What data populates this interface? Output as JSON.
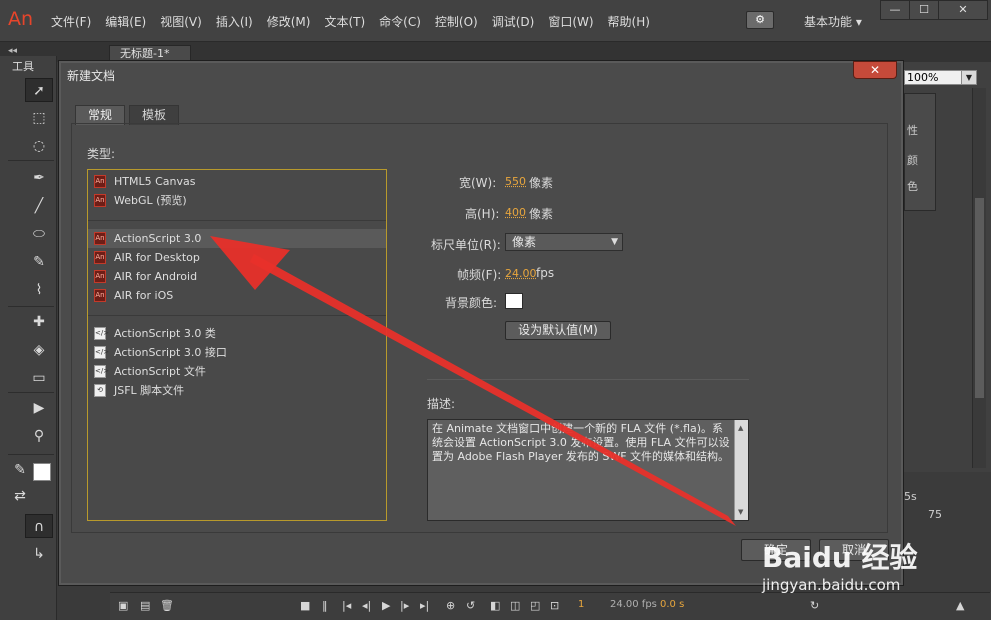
{
  "app": {
    "logo": "An",
    "menus": [
      "文件(F)",
      "编辑(E)",
      "视图(V)",
      "插入(I)",
      "修改(M)",
      "文本(T)",
      "命令(C)",
      "控制(O)",
      "调试(D)",
      "窗口(W)",
      "帮助(H)"
    ],
    "workspace": "基本功能",
    "doc_tab": "无标题-1*",
    "tools_label": "工具",
    "zoom": "100%",
    "props_fragments": [
      "性",
      "颜",
      "色"
    ]
  },
  "dialog": {
    "title": "新建文档",
    "close_label": "✕",
    "tabs": [
      "常规",
      "模板"
    ],
    "type_label": "类型:",
    "types_group1": [
      "HTML5 Canvas",
      "WebGL (预览)"
    ],
    "types_group2": [
      "ActionScript 3.0",
      "AIR for Desktop",
      "AIR for Android",
      "AIR for iOS"
    ],
    "types_group3": [
      "ActionScript 3.0 类",
      "ActionScript 3.0 接口",
      "ActionScript 文件",
      "JSFL 脚本文件"
    ],
    "selected_type": "ActionScript 3.0",
    "width_label": "宽(W):",
    "width_value": "550",
    "height_label": "高(H):",
    "height_value": "400",
    "unit_pixels": "像素",
    "ruler_label": "标尺单位(R):",
    "ruler_value": "像素",
    "fps_label": "帧频(F):",
    "fps_value": "24.00",
    "fps_unit": "fps",
    "bg_label": "背景颜色:",
    "bg_color": "#ffffff",
    "default_button": "设为默认值(M)",
    "desc_label": "描述:",
    "description": "在 Animate 文档窗口中创建一个新的 FLA 文件 (*.fla)。系统会设置 ActionScript 3.0 发布设置。使用 FLA 文件可以设置为 Adobe Flash Player 发布的 SWF 文件的媒体和结构。",
    "ok_button": "确定",
    "cancel_button": "取消"
  },
  "timeline": {
    "frame": "1",
    "fps": "24.00 fps",
    "time": "0.0 s",
    "ruler_marks": [
      "5s",
      "75"
    ]
  },
  "watermark": {
    "main": "Baidu 经验",
    "sub": "jingyan.baidu.com"
  },
  "colors": {
    "accent_arrow": "#e8302a",
    "list_border": "#b89a2c",
    "value_orange": "#e8a63d"
  }
}
